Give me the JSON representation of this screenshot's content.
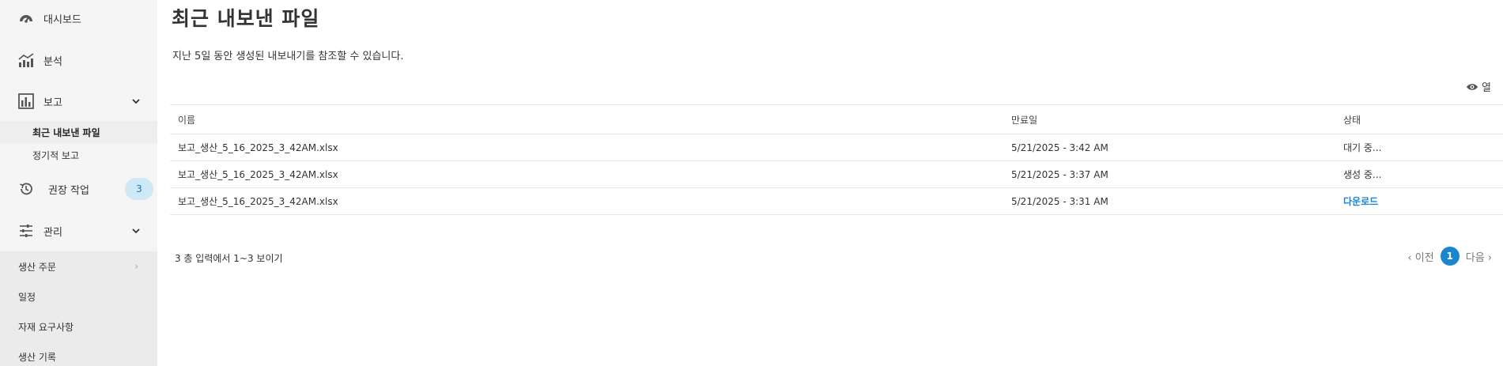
{
  "sidebar": {
    "dashboard": {
      "label": "대시보드",
      "icon": "gauge-icon"
    },
    "analytics": {
      "label": "분석",
      "icon": "line-chart-icon"
    },
    "reports": {
      "label": "보고",
      "icon": "bar-chart-icon",
      "expanded": true
    },
    "report_sub": [
      {
        "label": "최근 내보낸 파일",
        "active": true
      },
      {
        "label": "정기적 보고",
        "active": false
      }
    ],
    "recommended": {
      "label": "권장 작업",
      "icon": "history-icon",
      "badge": "3"
    },
    "manage": {
      "label": "관리",
      "icon": "sliders-icon",
      "expanded": true
    },
    "manage_sub": [
      {
        "label": "생산 주문",
        "has_chevron": true
      },
      {
        "label": "일정",
        "has_chevron": false
      },
      {
        "label": "자재 요구사항",
        "has_chevron": false
      },
      {
        "label": "생산 기록",
        "has_chevron": false
      }
    ]
  },
  "main": {
    "title": "최근 내보낸 파일",
    "subtitle": "지난 5일 동안 생성된 내보내기를 참조할 수 있습니다.",
    "columns_toggle": {
      "label": "열",
      "icon": "eye-icon"
    },
    "table": {
      "headers": [
        "이름",
        "만료일",
        "상태"
      ],
      "rows": [
        {
          "name": "보고_생산_5_16_2025_3_42AM.xlsx",
          "expires": "5/21/2025 - 3:42 AM",
          "status": "대기 중...",
          "status_type": "pending"
        },
        {
          "name": "보고_생산_5_16_2025_3_42AM.xlsx",
          "expires": "5/21/2025 - 3:37 AM",
          "status": "생성 중...",
          "status_type": "generating"
        },
        {
          "name": "보고_생산_5_16_2025_3_42AM.xlsx",
          "expires": "5/21/2025 - 3:31 AM",
          "status": "다운로드",
          "status_type": "download"
        }
      ]
    },
    "footer": {
      "count_text": "3 총 입력에서 1~3 보이기",
      "prev_label": "‹ 이전",
      "current_page": "1",
      "next_label": "다음 ›"
    }
  },
  "colors": {
    "accent": "#1a86d0",
    "sidebar_bg": "#f5f5f5",
    "badge_bg": "#cfe8f6"
  }
}
